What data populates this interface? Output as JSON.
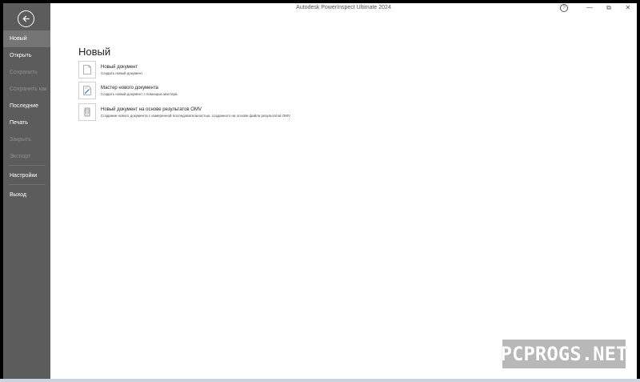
{
  "window": {
    "title": "Autodesk PowerInspect Ultimate 2024",
    "controls": {
      "help": "?",
      "minimize": "—",
      "restore": "⧉",
      "close": "✕"
    }
  },
  "sidebar": {
    "back_icon": "back-arrow-icon",
    "items": [
      {
        "label": "Новый",
        "state": "active"
      },
      {
        "label": "Открыть",
        "state": "enabled"
      },
      {
        "label": "Сохранить",
        "state": "disabled"
      },
      {
        "label": "Сохранить как",
        "state": "disabled"
      },
      {
        "label": "Последние",
        "state": "enabled"
      },
      {
        "label": "Печать",
        "state": "enabled"
      },
      {
        "label": "Закрыть",
        "state": "disabled"
      },
      {
        "label": "Экспорт",
        "state": "disabled"
      },
      {
        "label": "Настройки",
        "state": "enabled"
      },
      {
        "label": "Выход",
        "state": "enabled"
      }
    ]
  },
  "main": {
    "title": "Новый",
    "options": [
      {
        "title": "Новый документ",
        "description": "Создать новый документ.",
        "icon": "blank-document-icon"
      },
      {
        "title": "Мастер нового документа",
        "description": "Создать новый документ с помощью мастера.",
        "icon": "wizard-icon"
      },
      {
        "title": "Новый документ на основе результатов OMV",
        "description": "Создание нового документа с измеренной последовательностью, созданного на основе файла результатов OMV",
        "icon": "omv-document-icon"
      }
    ]
  },
  "watermark": {
    "text": "PCPROGS.NET"
  },
  "colors": {
    "sidebar": "#5c5c5c",
    "sidebar_active": "#757575",
    "background": "#ffffff"
  }
}
